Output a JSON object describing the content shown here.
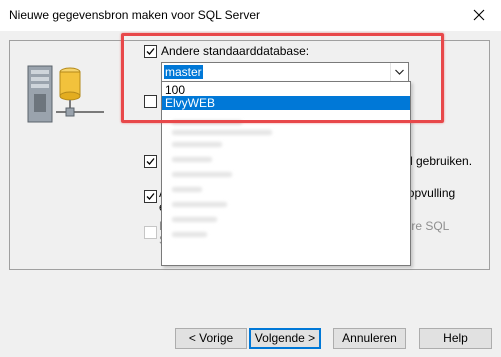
{
  "window": {
    "title": "Nieuwe gegevensbron maken voor SQL Server"
  },
  "options": {
    "default_db": {
      "label": "Andere standaarddatabase:",
      "checked": true
    },
    "combo": {
      "value": "master"
    },
    "dropdown": {
      "items": [
        "100",
        "ElvyWEB"
      ],
      "selected_index": 1
    },
    "second_cb": {
      "checked": false
    },
    "third_cb": {
      "label_visible": "d gebruiken.",
      "checked": true
    },
    "ansi": {
      "label": "ANSI-standaard gebruiken voor Null-waarden, opvulling en waarschuwingen.",
      "checked": true
    },
    "mirror": {
      "label": "De reserve-SQL Server gebruiken als de primaire SQL Server niet beschikbaar is.",
      "checked": false
    }
  },
  "buttons": {
    "back": "< Vorige",
    "next": "Volgende >",
    "cancel": "Annuleren",
    "help": "Help"
  },
  "colors": {
    "highlight": "#e8484a",
    "selection": "#0078d7"
  }
}
